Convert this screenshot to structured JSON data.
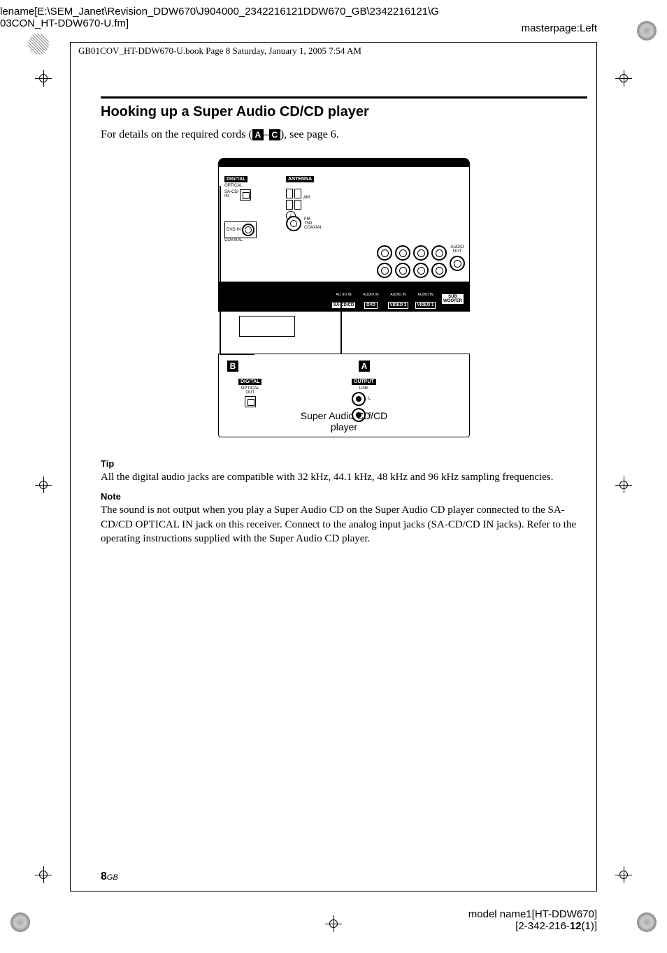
{
  "header": {
    "filename_line1": "lename[E:\\SEM_Janet\\Revision_DDW670\\J904000_2342216121DDW670_GB\\2342216121\\G",
    "filename_line2": "03CON_HT-DDW670-U.fm]",
    "masterpage": "masterpage:Left",
    "bookinfo": "GB01COV_HT-DDW670-U.book  Page 8  Saturday, January 1, 2005  7:54 AM"
  },
  "section": {
    "title": "Hooking up a Super Audio CD/CD player",
    "intro_prefix": "For details on the required cords (",
    "letter_a": "A",
    "intro_dash": "–",
    "letter_c": "C",
    "intro_suffix": "), see page 6."
  },
  "diagram": {
    "digital_label": "DIGITAL",
    "optical_label": "OPTICAL",
    "sacd_in_label": "SA-CD/\nIN",
    "antenna_label": "ANTENNA",
    "am_label": "AM",
    "fm_label": "FM\n75Ω\nCOAXIAL",
    "dvd_in_label": "DVD IN",
    "coaxial_label": "COAXIAL",
    "audio_out_label": "AUDIO\nOUT",
    "audio_in_label": "AUDIO IN",
    "col_sacd": "SA-CD/CD",
    "col_dvd": "DVD",
    "col_video2": "VIDEO 2",
    "col_video1": "VIDEO 1",
    "col_sub": "SUB\nWOOFER",
    "letter_b": "B",
    "letter_a": "A",
    "player_digital": "DIGITAL",
    "player_optical_out": "OPTICAL\nOUT",
    "player_output": "OUTPUT",
    "player_line": "LINE",
    "player_l": "L",
    "player_r": "R",
    "player_caption": "Super Audio CD/CD\nplayer"
  },
  "tip": {
    "heading": "Tip",
    "text": "All the digital audio jacks are compatible with 32 kHz, 44.1 kHz, 48 kHz and 96 kHz sampling frequencies."
  },
  "note": {
    "heading": "Note",
    "text": "The sound is not output when you play a Super Audio CD on the Super Audio CD player connected to the SA-CD/CD OPTICAL IN jack on this receiver. Connect to the analog input jacks (SA-CD/CD IN jacks). Refer to the operating instructions supplied with the Super Audio CD player."
  },
  "page": {
    "number": "8",
    "suffix": "GB"
  },
  "footer": {
    "model": "model name1[HT-DDW670]",
    "partno_prefix": "[2-342-216-",
    "partno_bold": "12",
    "partno_suffix": "(1)]"
  }
}
